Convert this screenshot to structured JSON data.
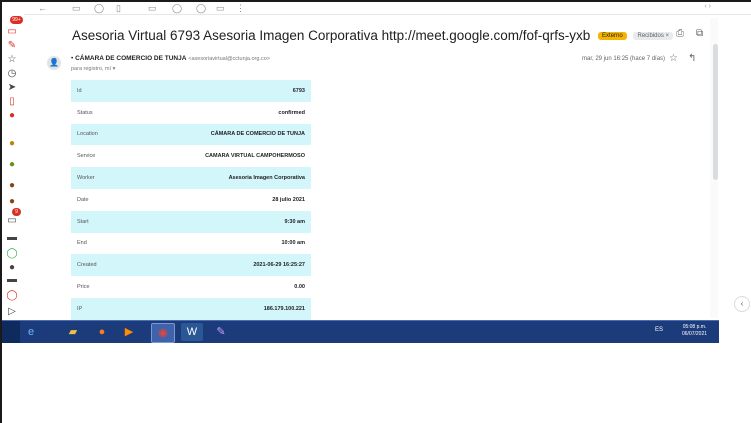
{
  "email": {
    "subject": "Asesoria Virtual 6793 Asesoria Imagen Corporativa http://meet.google.com/fof-qrfs-yxb",
    "tag_external": "Externo",
    "tag_inbox": "Recibidos ×",
    "sender_name": "CÁMARA DE COMERCIO DE TUNJA",
    "sender_email": "<asesoriavirtual@cctunja.org.co>",
    "recipients": "para registro, mí ▾",
    "date": "mar, 29 jun 16:25 (hace 7 días)"
  },
  "sidebar": {
    "badge_top": "99+",
    "badge_mid": "9"
  },
  "details": [
    {
      "key": "Id",
      "value": "6793"
    },
    {
      "key": "Status",
      "value": "confirmed"
    },
    {
      "key": "Location",
      "value": "CÁMARA DE COMERCIO DE TUNJA"
    },
    {
      "key": "Service",
      "value": "CAMARA VIRTUAL CAMPOHERMOSO"
    },
    {
      "key": "Worker",
      "value": "Asesoria Imagen Corporativa"
    },
    {
      "key": "Date",
      "value": "28 julio 2021"
    },
    {
      "key": "Start",
      "value": "9:30 am"
    },
    {
      "key": "End",
      "value": "10:00 am"
    },
    {
      "key": "Created",
      "value": "2021-06-29 16:25:27"
    },
    {
      "key": "Price",
      "value": "0.00"
    },
    {
      "key": "IP",
      "value": "186.179.100.221"
    }
  ],
  "taskbar": {
    "lang": "ES",
    "time": "05:08 p.m.",
    "date": "06/07/2021"
  },
  "colors": {
    "row_highlight": "#d3f6fb",
    "taskbar": "#1c3b7a",
    "tag_external": "#f4b400"
  }
}
